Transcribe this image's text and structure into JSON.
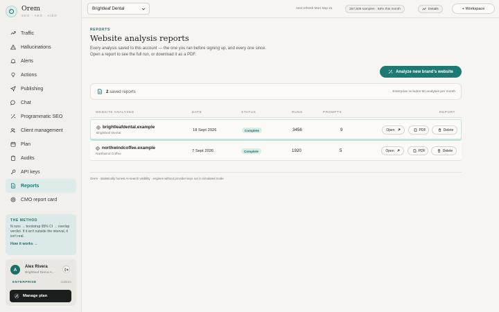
{
  "app": {
    "name": "Orem",
    "tagline": "SEO · AEO · AIEO"
  },
  "colors": {
    "accent": "#1d7974",
    "accent_light": "#dbece8",
    "dark": "#1c1e1e"
  },
  "sidebar": {
    "items": [
      {
        "label": "Traffic",
        "icon": "trend-icon"
      },
      {
        "label": "Hallucinations",
        "icon": "warning-icon"
      },
      {
        "label": "Alerts",
        "icon": "bell-icon"
      },
      {
        "label": "Actions",
        "icon": "lightbulb-icon"
      },
      {
        "label": "Publishing",
        "icon": "send-icon"
      },
      {
        "label": "Chat",
        "icon": "chat-icon"
      },
      {
        "label": "Programmatic SEO",
        "icon": "sparkles-icon"
      },
      {
        "label": "Client management",
        "icon": "users-icon"
      },
      {
        "label": "Plan",
        "icon": "calendar-icon"
      },
      {
        "label": "Audits",
        "icon": "clipboard-icon"
      },
      {
        "label": "API keys",
        "icon": "key-icon"
      },
      {
        "label": "Reports",
        "icon": "document-icon",
        "active": true
      },
      {
        "label": "CMO report card",
        "icon": "target-icon"
      }
    ],
    "method": {
      "title": "THE METHOD",
      "text": "N runs → bootstrap 95% CI → overlap verdict. If it isn't outside the interval, it isn't real.",
      "link": "How it works →"
    },
    "user": {
      "initial": "A",
      "name": "Alex Rivera",
      "org": "Brightleaf Demo A...",
      "plan": "ENTERPRISE",
      "plan_note": "custom",
      "manage_label": "Manage plan"
    }
  },
  "topbar": {
    "brand_select": "Brightleaf Dental",
    "refresh": "next refresh Mon Sep 21",
    "samples": "287,509 samples · 58% this month",
    "details": "Details",
    "workspace": "+ Workspace"
  },
  "page": {
    "kicker": "REPORTS",
    "title": "Website analysis reports",
    "desc_line1": "Every analysis saved to this account — the one you ran before signing up, and every one since.",
    "desc_line2": "Open a report to see the full run, or download it as a PDF.",
    "analyze_button": "Analyze new brand's website",
    "saved_count": "2",
    "saved_label": "saved reports",
    "saved_note": "Enterprise includes 90 analyses per month"
  },
  "table": {
    "headers": {
      "site": "WEBSITE ANALYZED",
      "date": "DATE",
      "status": "STATUS",
      "runs": "RUNS",
      "prompts": "PROMPTS",
      "report": "REPORT"
    },
    "rows": [
      {
        "domain": "brightleafdental.example",
        "brand": "Brightleaf Dental",
        "date": "18 Sept 2026",
        "status": "Complete",
        "runs": "3456",
        "prompts": "9"
      },
      {
        "domain": "northwindcoffee.example",
        "brand": "Northwind Coffee",
        "date": "7 Sept 2026",
        "status": "Complete",
        "runs": "1920",
        "prompts": "5"
      }
    ],
    "actions": {
      "open": "Open",
      "pdf": "PDF",
      "delete": "Delete"
    }
  },
  "footer": "Orem · statistically honest AI-search visibility · engines without provider keys run in simulated mode"
}
